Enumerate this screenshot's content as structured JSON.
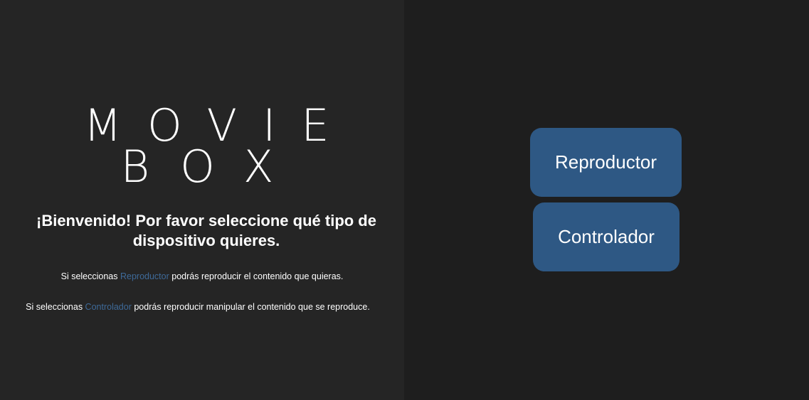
{
  "logo": {
    "line1": "MOVIE",
    "line2": "BOX"
  },
  "welcome": {
    "heading": "¡Bienvenido! Por favor seleccione qué tipo de dispositivo quieres."
  },
  "descriptions": [
    {
      "prefix": "Si seleccionas ",
      "highlight": "Reproductor",
      "suffix": " podrás reproducir el contenido que quieras."
    },
    {
      "prefix": "Si seleccionas ",
      "highlight": "Controlador",
      "suffix": " podrás reproducir manipular el contenido que se reproduce."
    }
  ],
  "buttons": {
    "reproductor": "Reproductor",
    "controlador": "Controlador"
  },
  "colors": {
    "left_panel_bg": "#252525",
    "right_panel_bg": "#1e1e1e",
    "button_bg": "#2e5884",
    "accent_text": "#3e6a99",
    "text": "#ffffff"
  }
}
